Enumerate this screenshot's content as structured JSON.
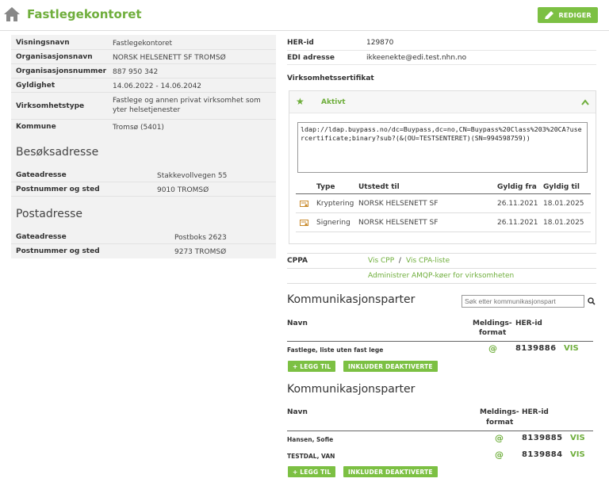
{
  "header": {
    "title": "Fastlegekontoret",
    "edit_label": "REDIGER"
  },
  "org": [
    {
      "k": "Visningsnavn",
      "v": "Fastlegekontoret"
    },
    {
      "k": "Organisasjonsnavn",
      "v": "NORSK HELSENETT SF TROMSØ"
    },
    {
      "k": "Organisasjonsnummer",
      "v": "887 950 342"
    },
    {
      "k": "Gyldighet",
      "v": "14.06.2022 - 14.06.2042"
    },
    {
      "k": "Virksomhetstype",
      "v": "Fastlege og annen privat virksomhet som yter helsetjenester"
    },
    {
      "k": "Kommune",
      "v": "Tromsø (5401)"
    }
  ],
  "besok": {
    "title": "Besøksadresse",
    "rows": [
      {
        "k": "Gateadresse",
        "v": "Stakkevollvegen 55"
      },
      {
        "k": "Postnummer og sted",
        "v": "9010 TROMSØ"
      }
    ]
  },
  "post": {
    "title": "Postadresse",
    "rows": [
      {
        "k": "Gateadresse",
        "v": "Postboks 2623"
      },
      {
        "k": "Postnummer og sted",
        "v": "9273 TROMSØ"
      }
    ]
  },
  "right": {
    "her_k": "HER-id",
    "her_v": "129870",
    "edi_k": "EDI adresse",
    "edi_v": "ikkeenekte@edi.test.nhn.no",
    "cert_title": "Virksomhetssertifikat"
  },
  "cert": {
    "status": "Aktivt",
    "ldap": "ldap://ldap.buypass.no/dc=Buypass,dc=no,CN=Buypass%20Class%203%20CA?usercertificate;binary?sub?(&(OU=TESTSENTERET)(SN=994598759))",
    "cols": [
      "Type",
      "Utstedt til",
      "Gyldig fra",
      "Gyldig til"
    ],
    "rows": [
      {
        "type": "Kryptering",
        "to": "NORSK HELSENETT SF",
        "from": "26.11.2021",
        "until": "18.01.2025"
      },
      {
        "type": "Signering",
        "to": "NORSK HELSENETT SF",
        "from": "26.11.2021",
        "until": "18.01.2025"
      }
    ]
  },
  "cppa": {
    "label": "CPPA",
    "vis_cpp": "Vis CPP",
    "sep": " / ",
    "vis_cpa": "Vis CPA-liste",
    "amqp": "Administrer AMQP-køer for virksomheten"
  },
  "komm1": {
    "title": "Kommunikasjonsparter",
    "search_placeholder": "Søk etter kommunikasjonspart",
    "col_navn": "Navn",
    "col_format_1": "Meldings-",
    "col_format_2": "format",
    "col_her": "HER-id",
    "rows": [
      {
        "name": "Fastlege, liste uten fast lege",
        "fmt": "@",
        "her": "8139886",
        "vis": "VIS"
      }
    ],
    "add": "+ LEGG TIL",
    "inkl": "INKLUDER DEAKTIVERTE"
  },
  "komm2": {
    "title": "Kommunikasjonsparter",
    "col_navn": "Navn",
    "col_format_1": "Meldings-",
    "col_format_2": "format",
    "col_her": "HER-id",
    "rows": [
      {
        "name": "Hansen, Sofie",
        "fmt": "@",
        "her": "8139885",
        "vis": "VIS"
      },
      {
        "name": "TESTDAL, VAN",
        "fmt": "@",
        "her": "8139884",
        "vis": "VIS"
      }
    ],
    "add": "+ LEGG TIL",
    "inkl": "INKLUDER DEAKTIVERTE"
  },
  "colors": {
    "accent": "#6fae3c",
    "button": "#7cc043",
    "panel": "#f2f2f2"
  }
}
